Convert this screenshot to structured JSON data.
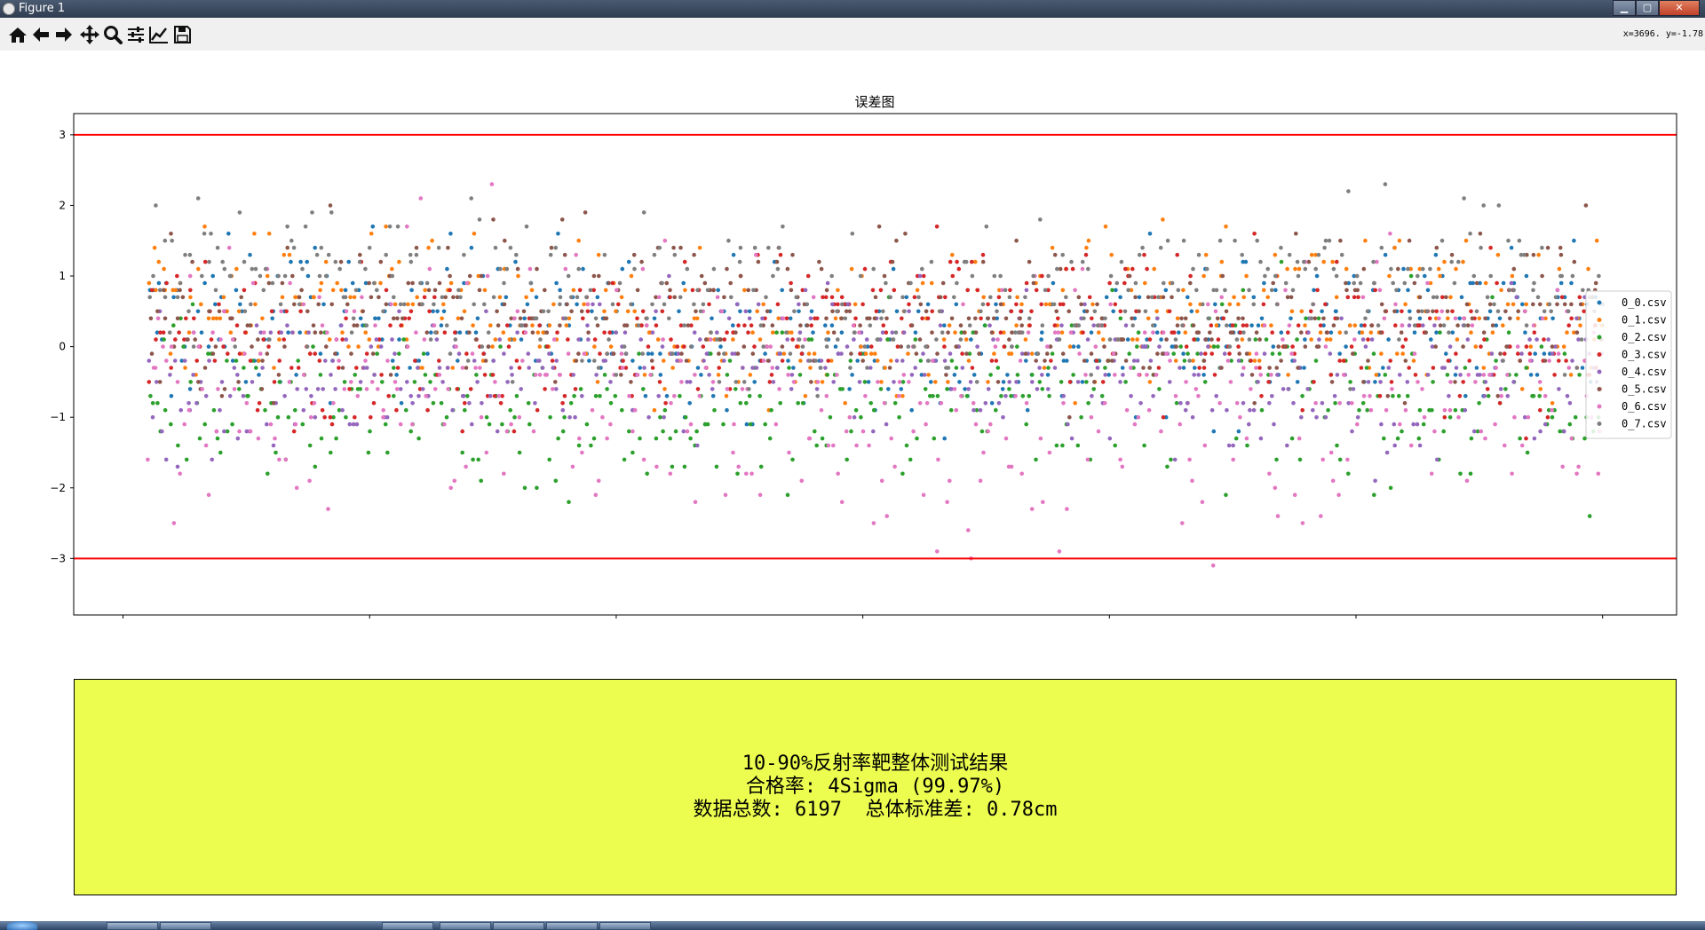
{
  "window": {
    "title": "Figure 1",
    "controls": {
      "minimize": "▁",
      "maximize": "▢",
      "close": "✕"
    }
  },
  "toolbar": {
    "buttons": [
      {
        "name": "home",
        "icon": "home-icon"
      },
      {
        "name": "back",
        "icon": "arrow-left-icon"
      },
      {
        "name": "forward",
        "icon": "arrow-right-icon"
      },
      {
        "name": "pan",
        "icon": "move-icon"
      },
      {
        "name": "zoom",
        "icon": "magnifier-icon"
      },
      {
        "name": "configure-subplots",
        "icon": "sliders-icon"
      },
      {
        "name": "edit-axes",
        "icon": "line-chart-icon"
      },
      {
        "name": "save",
        "icon": "floppy-icon"
      }
    ],
    "coordinates": "x=3696.  y=-1.78"
  },
  "chart_data": {
    "type": "scatter",
    "title": "误差图",
    "xlabel": "",
    "ylabel": "",
    "xlim": [
      -200,
      6300
    ],
    "ylim": [
      -3.8,
      3.3
    ],
    "xticks": [
      0,
      1000,
      2000,
      3000,
      4000,
      5000,
      6000
    ],
    "yticks": [
      3,
      2,
      1,
      0,
      -1,
      -2,
      -3
    ],
    "x_range_of_points": [
      100,
      6000
    ],
    "hlines": [
      {
        "y": 3,
        "color": "#ff0000"
      },
      {
        "y": -3,
        "color": "#ff0000"
      }
    ],
    "legend_position": "right",
    "series": [
      {
        "name": "0_0.csv",
        "color": "#1f77b4",
        "center": 0.2,
        "spread": 0.55
      },
      {
        "name": "0_1.csv",
        "color": "#ff7f0e",
        "center": 0.35,
        "spread": 0.5
      },
      {
        "name": "0_2.csv",
        "color": "#2ca02c",
        "center": -0.7,
        "spread": 0.6
      },
      {
        "name": "0_3.csv",
        "color": "#d62728",
        "center": 0.2,
        "spread": 0.5
      },
      {
        "name": "0_4.csv",
        "color": "#9467bd",
        "center": -0.3,
        "spread": 0.5
      },
      {
        "name": "0_5.csv",
        "color": "#8c564b",
        "center": 0.45,
        "spread": 0.55
      },
      {
        "name": "0_6.csv",
        "color": "#e377c2",
        "center": -0.6,
        "spread": 0.9
      },
      {
        "name": "0_7.csv",
        "color": "#7f7f7f",
        "center": 0.7,
        "spread": 0.55
      }
    ]
  },
  "result_box": {
    "background": "#ecfd4f",
    "line1": "10-90%反射率靶整体测试结果",
    "line2": "合格率: 4Sigma (99.97%)",
    "line3": "数据总数: 6197  总体标准差: 0.78cm"
  }
}
